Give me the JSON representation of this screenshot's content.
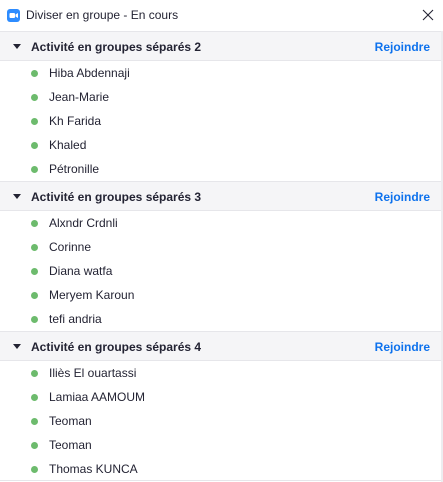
{
  "window": {
    "title": "Diviser en groupe - En cours",
    "app_icon": "zoom-camera-icon",
    "close_icon": "close-x-icon",
    "accent_color": "#2d8cff"
  },
  "colors": {
    "join_link": "#0e72ed",
    "online_dot": "#6dbb6d",
    "header_bg": "#f5f5f7"
  },
  "groups": [
    {
      "title": "Activité en groupes séparés 2",
      "join_label": "Rejoindre",
      "members": [
        "Hiba Abdennaji",
        "Jean-Marie",
        "Kh Farida",
        "Khaled",
        "Pétronille"
      ]
    },
    {
      "title": "Activité en groupes séparés 3",
      "join_label": "Rejoindre",
      "members": [
        "Alxndr Crdnli",
        "Corinne",
        "Diana watfa",
        "Meryem Karoun",
        "tefi andria"
      ]
    },
    {
      "title": "Activité en groupes séparés 4",
      "join_label": "Rejoindre",
      "members": [
        "Iliès El ouartassi",
        "Lamiaa AAMOUM",
        "Teoman",
        "Teoman",
        "Thomas KUNCA"
      ]
    }
  ]
}
